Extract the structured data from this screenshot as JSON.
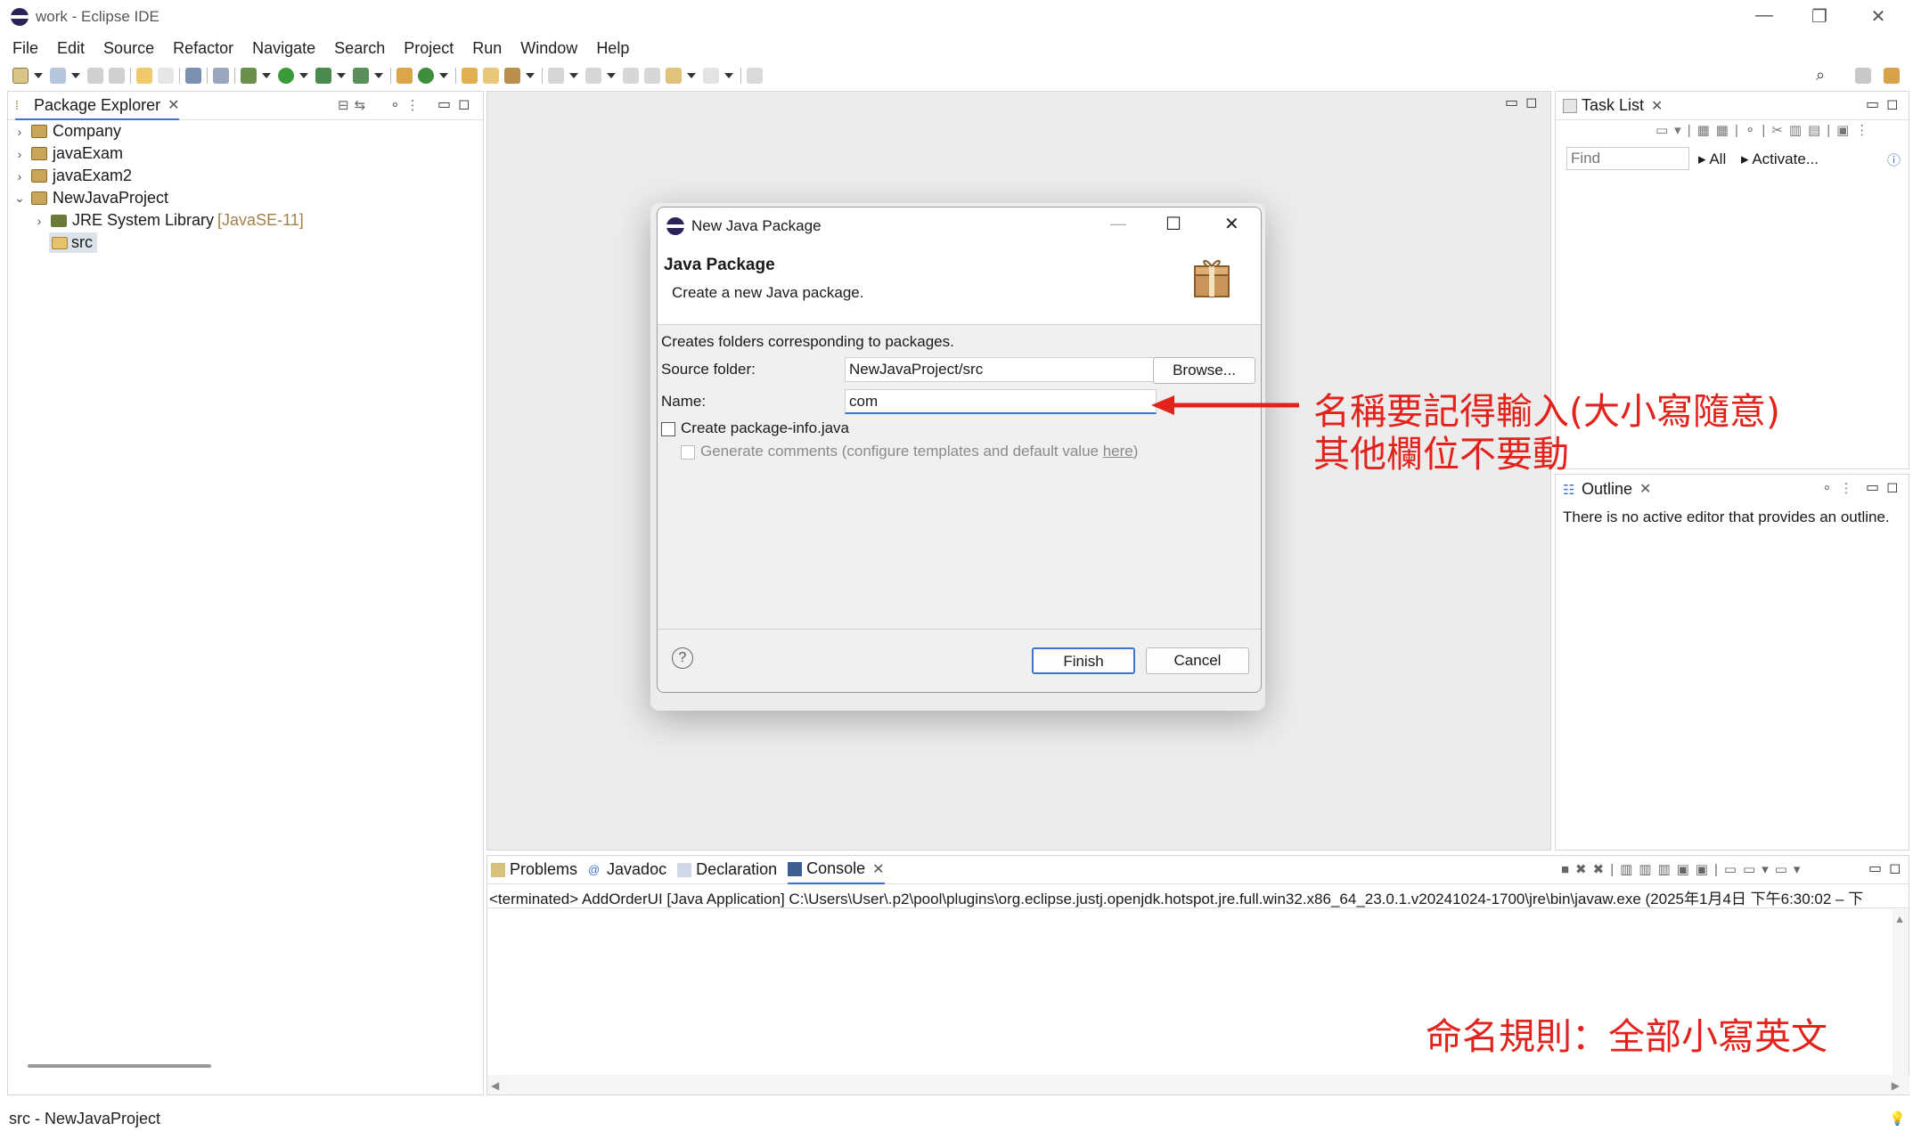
{
  "window": {
    "title": "work - Eclipse IDE"
  },
  "menu": [
    "File",
    "Edit",
    "Source",
    "Refactor",
    "Navigate",
    "Search",
    "Project",
    "Run",
    "Window",
    "Help"
  ],
  "package_explorer": {
    "tab_label": "Package Explorer",
    "tree": [
      {
        "label": "Company"
      },
      {
        "label": "javaExam"
      },
      {
        "label": "javaExam2"
      },
      {
        "label": "NewJavaProject"
      },
      {
        "label": "JRE System Library",
        "decoration": "[JavaSE-11]"
      },
      {
        "label": "src"
      }
    ]
  },
  "task_list": {
    "tab_label": "Task List",
    "find_placeholder": "Find",
    "filter_all": "All",
    "filter_activate": "Activate..."
  },
  "outline": {
    "tab_label": "Outline",
    "message": "There is no active editor that provides an outline."
  },
  "bottom": {
    "tabs": [
      "Problems",
      "Javadoc",
      "Declaration",
      "Console"
    ],
    "active_tab": "Console",
    "console_line": "<terminated> AddOrderUI [Java Application] C:\\Users\\User\\.p2\\pool\\plugins\\org.eclipse.justj.openjdk.hotspot.jre.full.win32.x86_64_23.0.1.v20241024-1700\\jre\\bin\\javaw.exe  (2025年1月4日 下午6:30:02 – 下"
  },
  "status_bar": {
    "text": "src - NewJavaProject"
  },
  "dialog": {
    "title": "New Java Package",
    "header_title": "Java Package",
    "header_desc": "Create a new Java package.",
    "intro": "Creates folders corresponding to packages.",
    "source_folder_label": "Source folder:",
    "source_folder_value": "NewJavaProject/src",
    "browse_label": "Browse...",
    "name_label": "Name:",
    "name_value": "com",
    "create_info_label": "Create package-info.java",
    "generate_comments_label": "Generate comments (configure templates and default value ",
    "generate_comments_link": "here",
    "generate_comments_suffix": ")",
    "finish_label": "Finish",
    "cancel_label": "Cancel",
    "help_glyph": "?"
  },
  "annotations": {
    "line1": "名稱要記得輸入(大小寫隨意)",
    "line2": "其他欄位不要動",
    "naming_rule": "命名規則：全部小寫英文",
    "color": "#e3221c"
  }
}
